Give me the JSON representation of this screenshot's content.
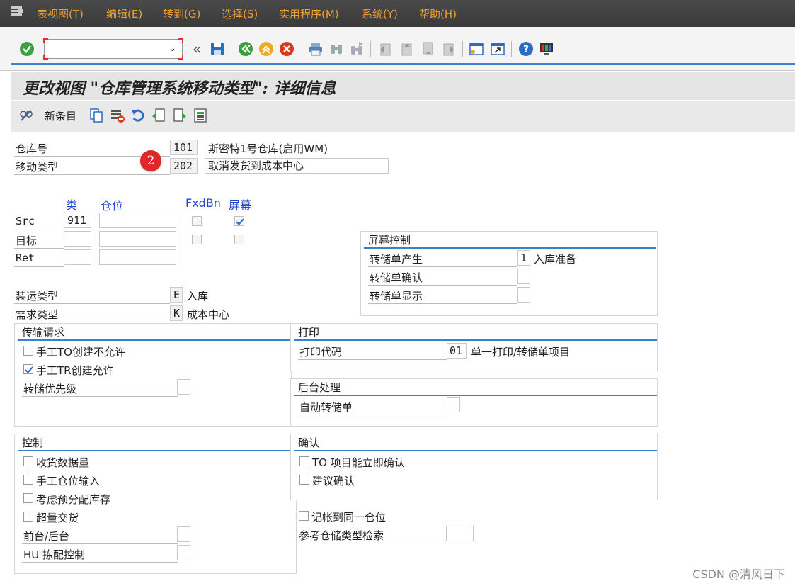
{
  "menu": [
    "表视图(T)",
    "编辑(E)",
    "转到(G)",
    "选择(S)",
    "实用程序(M)",
    "系统(Y)",
    "帮助(H)"
  ],
  "command_field": {
    "value": ""
  },
  "title": "更改视图 \"仓库管理系统移动类型\": 详细信息",
  "app_toolbar": {
    "new_entries": "新条目"
  },
  "header_fields": {
    "warehouse_label": "仓库号",
    "warehouse_value": "101",
    "warehouse_desc": "斯密特1号仓库(启用WM)",
    "movement_type_label": "移动类型",
    "movement_type_value": "202",
    "movement_type_desc": "取消发货到成本中心"
  },
  "badge": "2",
  "storage_columns": {
    "type": "类",
    "bin": "仓位",
    "fxdbn": "FxdBn",
    "screen": "屏幕"
  },
  "storage_rows": [
    {
      "label": "Src",
      "type": "911",
      "bin": "",
      "fxdbn": false,
      "screen": true
    },
    {
      "label": "目标",
      "type": "",
      "bin": "",
      "fxdbn": false,
      "screen": false
    },
    {
      "label": "Ret",
      "type": "",
      "bin": ""
    }
  ],
  "screen_control": {
    "title": "屏幕控制",
    "rows": [
      {
        "label": "转储单产生",
        "value": "1",
        "desc": "入库准备"
      },
      {
        "label": "转储单确认",
        "value": ""
      },
      {
        "label": "转储单显示",
        "value": ""
      }
    ]
  },
  "shipment_type": {
    "label": "装运类型",
    "value": "E",
    "desc": "入库"
  },
  "requirement_type": {
    "label": "需求类型",
    "value": "K",
    "desc": "成本中心"
  },
  "transfer_request": {
    "title": "传输请求",
    "manual_to_not_allowed": {
      "label": "手工TO创建不允许",
      "checked": false
    },
    "manual_tr_allowed": {
      "label": "手工TR创建允许",
      "checked": true
    },
    "priority_label": "转储优先级",
    "priority_value": ""
  },
  "print": {
    "title": "打印",
    "code_label": "打印代码",
    "code_value": "01",
    "code_desc": "单一打印/转储单项目"
  },
  "background": {
    "title": "后台处理",
    "auto_to_label": "自动转储单",
    "auto_to_value": ""
  },
  "control": {
    "title": "控制",
    "checks": [
      {
        "label": "收货数据量",
        "checked": false
      },
      {
        "label": "手工仓位输入",
        "checked": false
      },
      {
        "label": "考虑预分配库存",
        "checked": false
      },
      {
        "label": "超量交货",
        "checked": false
      }
    ],
    "fg_bg_label": "前台/后台",
    "fg_bg_value": "",
    "hu_label": "HU 拣配控制",
    "hu_value": ""
  },
  "confirm": {
    "title": "确认",
    "checks": [
      {
        "label": "TO 项目能立即确认",
        "checked": false
      },
      {
        "label": "建议确认",
        "checked": false
      }
    ],
    "post_same_bin": {
      "label": "记帐到同一仓位",
      "checked": false
    },
    "ref_storage_label": "参考仓储类型检索",
    "ref_storage_value": ""
  },
  "watermark": "CSDN @清风日下"
}
